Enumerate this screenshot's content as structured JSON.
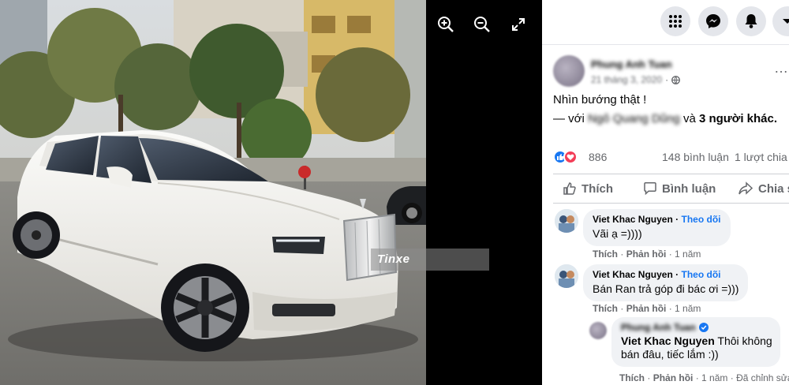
{
  "viewer": {
    "watermark": "Tinxe",
    "tools": [
      {
        "name": "zoom-in",
        "icon": "zoom-in-icon"
      },
      {
        "name": "zoom-out",
        "icon": "zoom-out-icon"
      },
      {
        "name": "fullscreen",
        "icon": "fullscreen-icon"
      }
    ],
    "plate_color": "#ffffff",
    "car_color": "#f4f4f2"
  },
  "topbar": {
    "buttons": [
      "menu-grid-icon",
      "messenger-icon",
      "notifications-icon",
      "account-dropdown-icon"
    ]
  },
  "post": {
    "author": "Phung Anh Tuan",
    "date": "21 tháng 3, 2020",
    "privacy_icon": "globe-icon",
    "more_label": "…",
    "caption": "Nhìn bướng thật !",
    "tag_prefix": "— với",
    "tagged_name": "Ngô Quang Dũng",
    "tag_conjunction": "và",
    "tag_others": "3 người khác."
  },
  "stats": {
    "reaction_count": "886",
    "comments": "148 bình luận",
    "shares": "1 lượt chia"
  },
  "actions": {
    "like": "Thích",
    "comment": "Bình luận",
    "share": "Chia s"
  },
  "comments": [
    {
      "name": "Viet Khac Nguyen",
      "follow": "Theo dõi",
      "text": "Vãi ạ =))))",
      "like": "Thích",
      "reply": "Phản hồi",
      "time": "1 năm"
    },
    {
      "name": "Viet Khac Nguyen",
      "follow": "Theo dõi",
      "text": "Bán Ran trả góp đi bác ơi =)))",
      "like": "Thích",
      "reply": "Phản hồi",
      "time": "1 năm"
    }
  ],
  "reply": {
    "name": "Phung Anh Tuan",
    "mention": "Viet Khac Nguyen",
    "text_line1": "Thôi không",
    "text_line2": "bán đâu, tiếc lắm :))",
    "like": "Thích",
    "reply": "Phản hồi",
    "time": "1 năm",
    "edited": "Đã chỉnh sửa"
  },
  "colors": {
    "accent": "#1877f2",
    "love": "#f33e58",
    "muted_text": "#65676b",
    "bubble": "#f0f2f5"
  }
}
